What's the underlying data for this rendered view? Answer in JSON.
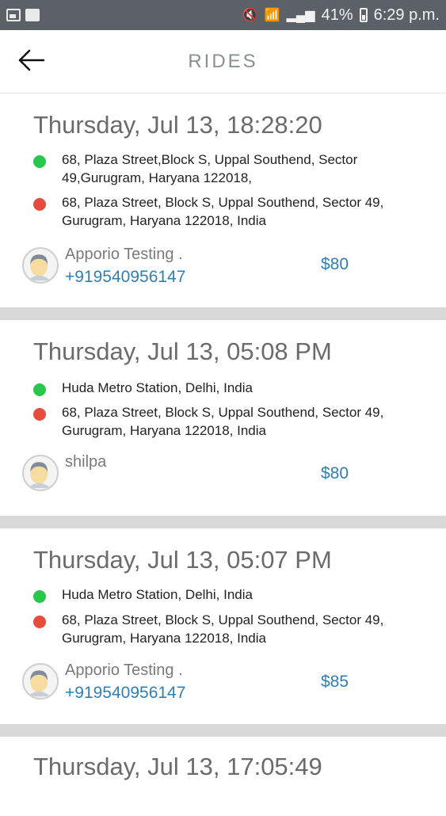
{
  "status_bar": {
    "battery_percent": "41%",
    "time": "6:29 p.m."
  },
  "header": {
    "title": "RIDES"
  },
  "rides": [
    {
      "date": "Thursday, Jul 13, 18:28:20",
      "pickup": "68, Plaza Street,Block S, Uppal Southend, Sector 49,Gurugram, Haryana 122018,",
      "drop": "68, Plaza Street, Block S, Uppal Southend, Sector 49, Gurugram, Haryana 122018, India",
      "rider_name": "Apporio Testing .",
      "rider_phone": "+919540956147",
      "fare": "$80"
    },
    {
      "date": "Thursday, Jul 13, 05:08 PM",
      "pickup": "Huda Metro Station, Delhi, India",
      "drop": "68, Plaza Street, Block S, Uppal Southend, Sector 49, Gurugram, Haryana 122018, India",
      "rider_name": "shilpa",
      "rider_phone": "",
      "fare": "$80"
    },
    {
      "date": "Thursday, Jul 13, 05:07 PM",
      "pickup": "Huda Metro Station, Delhi, India",
      "drop": "68, Plaza Street, Block S, Uppal Southend, Sector 49, Gurugram, Haryana 122018, India",
      "rider_name": "Apporio Testing .",
      "rider_phone": "+919540956147",
      "fare": "$85"
    },
    {
      "date": "Thursday, Jul 13, 17:05:49"
    }
  ],
  "colors": {
    "pickup_dot": "#27c74d",
    "drop_dot": "#e64b3c",
    "link": "#2f7fb5"
  },
  "icons": {
    "back": "arrow-left-icon",
    "avatar": "user-avatar-icon"
  }
}
